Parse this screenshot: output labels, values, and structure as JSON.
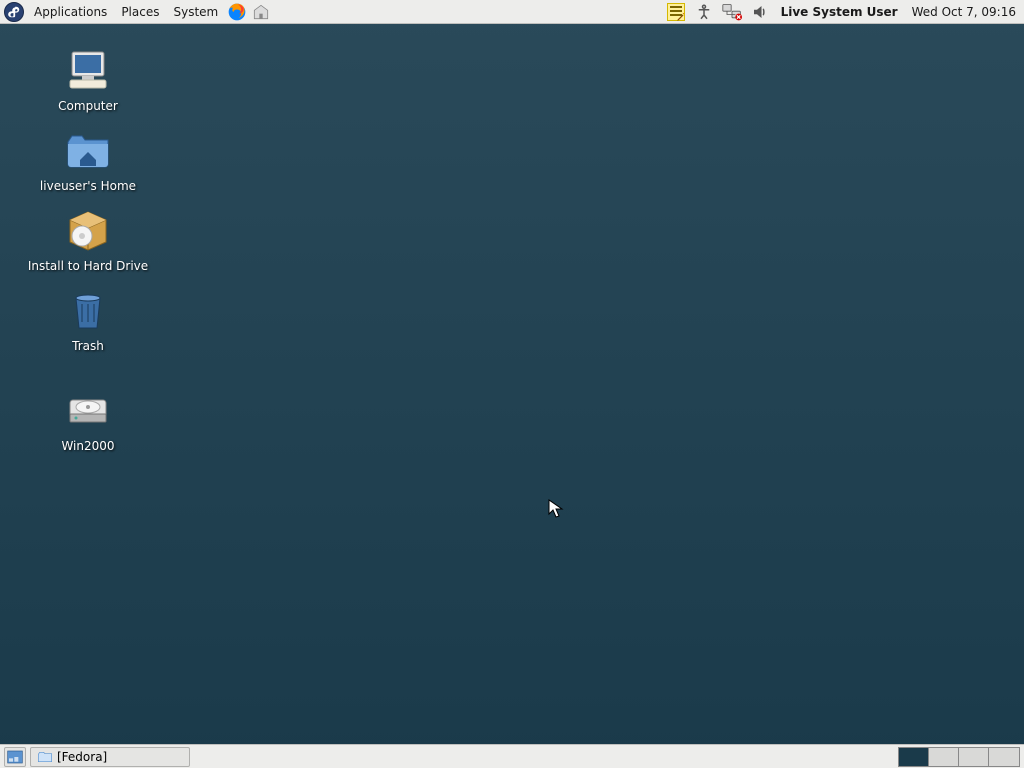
{
  "topPanel": {
    "menus": {
      "applications": "Applications",
      "places": "Places",
      "system": "System"
    },
    "user": "Live System User",
    "clock": "Wed Oct  7, 09:16"
  },
  "desktopIcons": {
    "computer": "Computer",
    "home": "liveuser's Home",
    "install": "Install to Hard Drive",
    "trash": "Trash",
    "win2000": "Win2000"
  },
  "bottomPanel": {
    "taskLabel": "[Fedora]"
  }
}
